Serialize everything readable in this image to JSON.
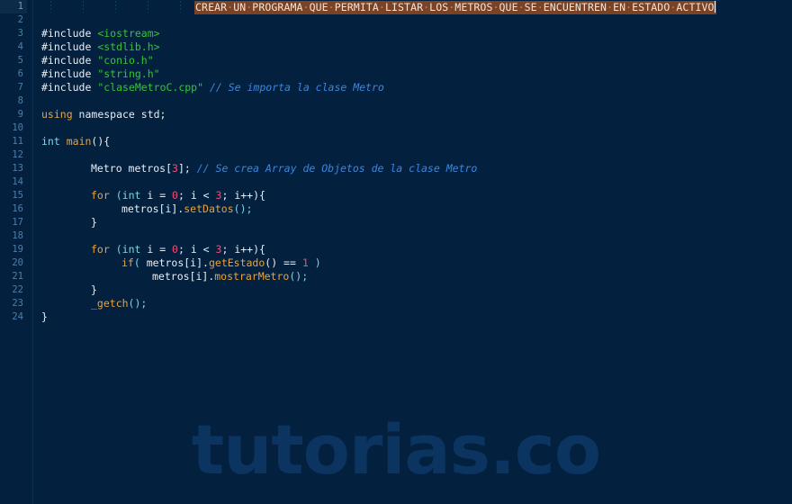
{
  "editor": {
    "background_color": "#03213f",
    "gutter_color": "#4e7ea8",
    "selection_color": "#7b4326",
    "watermark": "tutorias.co",
    "title_line": {
      "text": "CREAR UN PROGRAMA QUE PERMITA LISTAR LOS METROS QUE SE ENCUENTREN EN ESTADO ACTIVO",
      "selected": true,
      "caret_at_end": true
    },
    "line_numbers": [
      "1",
      "2",
      "3",
      "4",
      "5",
      "6",
      "7",
      "8",
      "9",
      "10",
      "11",
      "12",
      "13",
      "14",
      "15",
      "16",
      "17",
      "18",
      "19",
      "20",
      "21",
      "22",
      "23",
      "24"
    ],
    "code_lines": [
      {
        "n": "1",
        "text": ""
      },
      {
        "n": "2",
        "text": ""
      },
      {
        "n": "3",
        "text": "#include <iostream>"
      },
      {
        "n": "4",
        "text": "#include <stdlib.h>"
      },
      {
        "n": "5",
        "text": "#include \"conio.h\""
      },
      {
        "n": "6",
        "text": "#include \"string.h\""
      },
      {
        "n": "7",
        "text": "#include \"claseMetroC.cpp\" // Se importa la clase Metro"
      },
      {
        "n": "8",
        "text": ""
      },
      {
        "n": "9",
        "text": "using namespace std;"
      },
      {
        "n": "10",
        "text": ""
      },
      {
        "n": "11",
        "text": "int main(){"
      },
      {
        "n": "12",
        "text": ""
      },
      {
        "n": "13",
        "text": "        Metro metros[3]; // Se crea Array de Objetos de la clase Metro"
      },
      {
        "n": "14",
        "text": ""
      },
      {
        "n": "15",
        "text": "        for (int i = 0; i < 3; i++){"
      },
      {
        "n": "16",
        "text": "            metros[i].setDatos();"
      },
      {
        "n": "17",
        "text": "        }"
      },
      {
        "n": "18",
        "text": ""
      },
      {
        "n": "19",
        "text": "        for (int i = 0; i < 3; i++){"
      },
      {
        "n": "20",
        "text": "            if( metros[i].getEstado() == 1 )"
      },
      {
        "n": "21",
        "text": "                metros[i].mostrarMetro();"
      },
      {
        "n": "22",
        "text": "        }"
      },
      {
        "n": "23",
        "text": "        _getch();"
      },
      {
        "n": "24",
        "text": "}"
      }
    ],
    "tokens": {
      "include_directive": "#include",
      "header_iostream": "<iostream>",
      "header_stdlib": "<stdlib.h>",
      "header_conio": "\"conio.h\"",
      "header_string": "\"string.h\"",
      "header_clase": "\"claseMetroC.cpp\"",
      "comment_import": "// Se importa la clase Metro",
      "kw_using": "using",
      "using_rest": " namespace std;",
      "kw_int": "int",
      "fn_main": "main",
      "main_tail": "(){",
      "metro_decl": "Metro metros[",
      "metro_size": "3",
      "metro_decl_end": "];",
      "comment_array": "// Se crea Array de Objetos de la clase Metro",
      "kw_for": "for",
      "for_open": " (",
      "for_init_type": "int",
      "for_init": " i = ",
      "num_zero": "0",
      "for_mid": "; i < ",
      "num_three": "3",
      "for_end": "; i++){",
      "obj_metros": "metros[i].",
      "fn_setdatos": "setDatos",
      "call_end": "();",
      "brace_close": "}",
      "kw_if": "if",
      "if_open": "( ",
      "fn_getestado": "getEstado",
      "if_mid": "() == ",
      "num_one": "1",
      "if_close": " )",
      "fn_mostrarmetro": "mostrarMetro",
      "fn_getch": "_getch",
      "getch_end": "();",
      "main_close": "}"
    }
  }
}
